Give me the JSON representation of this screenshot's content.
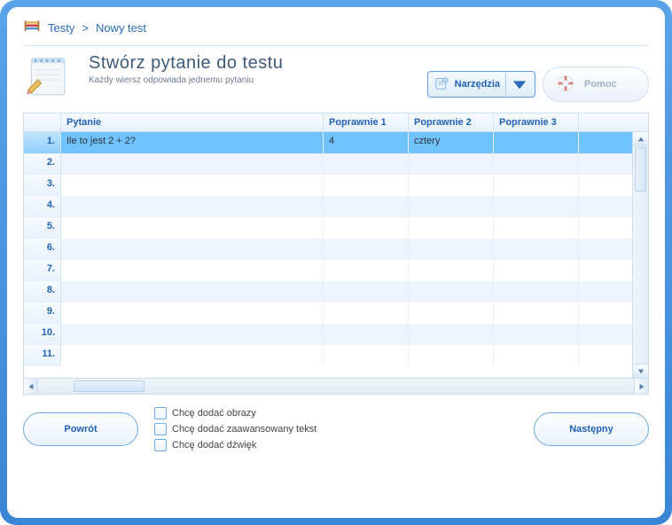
{
  "breadcrumb": {
    "root": "Testy",
    "sep": ">",
    "current": "Nowy test"
  },
  "header": {
    "title": "Stwórz pytanie do testu",
    "subtitle": "Każdy wiersz odpowiada jednemu pytaniu",
    "tools_label": "Narzędzia",
    "help_label": "Pomoc"
  },
  "grid": {
    "columns": {
      "question": "Pytanie",
      "correct1": "Poprawnie 1",
      "correct2": "Poprawnie 2",
      "correct3": "Poprawnie 3"
    },
    "rows": [
      {
        "n": "1.",
        "question": "Ile to jest 2 + 2?",
        "c1": "4",
        "c2": "cztery",
        "c3": "",
        "selected": true
      },
      {
        "n": "2.",
        "question": "",
        "c1": "",
        "c2": "",
        "c3": ""
      },
      {
        "n": "3.",
        "question": "",
        "c1": "",
        "c2": "",
        "c3": ""
      },
      {
        "n": "4.",
        "question": "",
        "c1": "",
        "c2": "",
        "c3": ""
      },
      {
        "n": "5.",
        "question": "",
        "c1": "",
        "c2": "",
        "c3": ""
      },
      {
        "n": "6.",
        "question": "",
        "c1": "",
        "c2": "",
        "c3": ""
      },
      {
        "n": "7.",
        "question": "",
        "c1": "",
        "c2": "",
        "c3": ""
      },
      {
        "n": "8.",
        "question": "",
        "c1": "",
        "c2": "",
        "c3": ""
      },
      {
        "n": "9.",
        "question": "",
        "c1": "",
        "c2": "",
        "c3": ""
      },
      {
        "n": "10.",
        "question": "",
        "c1": "",
        "c2": "",
        "c3": ""
      },
      {
        "n": "11.",
        "question": "",
        "c1": "",
        "c2": "",
        "c3": ""
      }
    ]
  },
  "footer": {
    "back": "Powrót",
    "next": "Następny",
    "check_images": "Chcę dodać obrazy",
    "check_rich": "Chcę dodać zaawansowany tekst",
    "check_sound": "Chcę dodać dźwięk"
  }
}
